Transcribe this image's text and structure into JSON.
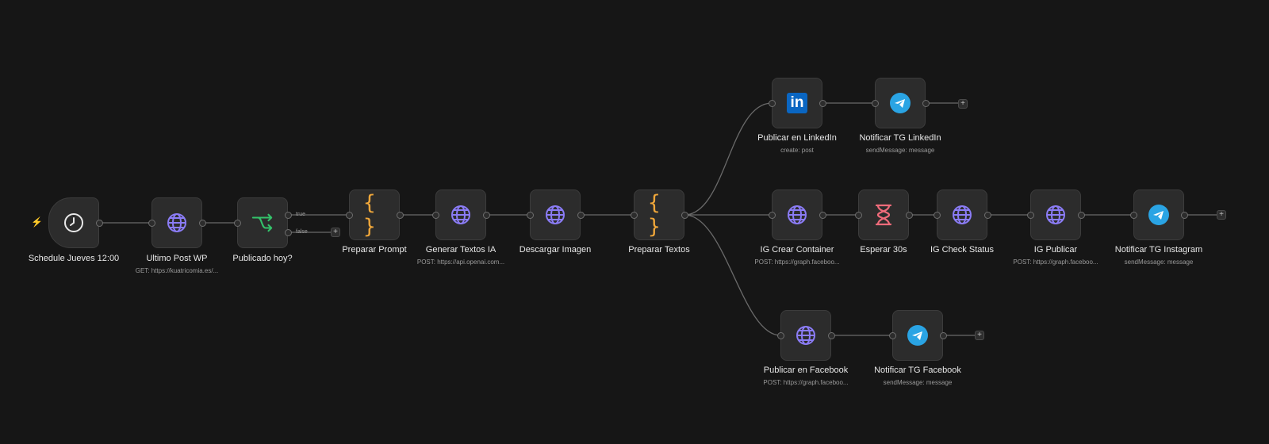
{
  "nodes": {
    "schedule": {
      "label": "Schedule Jueves 12:00",
      "sub": "",
      "icon": "clock-icon"
    },
    "ultimo": {
      "label": "Ultimo Post WP",
      "sub": "GET: https://kuatricomia.es/...",
      "icon": "globe-icon"
    },
    "publicado": {
      "label": "Publicado hoy?",
      "sub": "",
      "icon": "if-branch-icon",
      "branch_true": "true",
      "branch_false": "false"
    },
    "prompt": {
      "label": "Preparar Prompt",
      "sub": "",
      "icon": "code-braces-icon",
      "glyph": "{ }"
    },
    "generar": {
      "label": "Generar Textos IA",
      "sub": "POST: https://api.openai.com...",
      "icon": "globe-icon"
    },
    "descargar": {
      "label": "Descargar Imagen",
      "sub": "",
      "icon": "globe-icon"
    },
    "textos": {
      "label": "Preparar Textos",
      "sub": "",
      "icon": "code-braces-icon",
      "glyph": "{ }"
    },
    "linkedin": {
      "label": "Publicar en LinkedIn",
      "sub": "create: post",
      "icon": "linkedin-icon",
      "glyph": "in"
    },
    "tglinkedin": {
      "label": "Notificar TG LinkedIn",
      "sub": "sendMessage: message",
      "icon": "telegram-icon"
    },
    "igcrear": {
      "label": "IG Crear Container",
      "sub": "POST: https://graph.faceboo...",
      "icon": "globe-icon"
    },
    "esperar": {
      "label": "Esperar 30s",
      "sub": "",
      "icon": "hourglass-icon"
    },
    "igcheck": {
      "label": "IG Check Status",
      "sub": "",
      "icon": "globe-icon"
    },
    "igpublicar": {
      "label": "IG Publicar",
      "sub": "POST: https://graph.faceboo...",
      "icon": "globe-icon"
    },
    "tginstagram": {
      "label": "Notificar TG Instagram",
      "sub": "sendMessage: message",
      "icon": "telegram-icon"
    },
    "facebook": {
      "label": "Publicar en Facebook",
      "sub": "POST: https://graph.faceboo...",
      "icon": "globe-icon"
    },
    "tgfacebook": {
      "label": "Notificar TG Facebook",
      "sub": "sendMessage: message",
      "icon": "telegram-icon"
    }
  },
  "add_button_label": "+",
  "trigger_icon": "lightning-bolt-icon",
  "colors": {
    "background": "#161616",
    "node": "#2c2c2c",
    "wire": "#6a6a6a",
    "globe": "#8b7cf6",
    "code": "#f0a73a",
    "if": "#33c26a",
    "wait": "#ef6b7a",
    "telegram": "#2aa4e4",
    "linkedin": "#0a66c2",
    "trigger": "#e2473b"
  }
}
